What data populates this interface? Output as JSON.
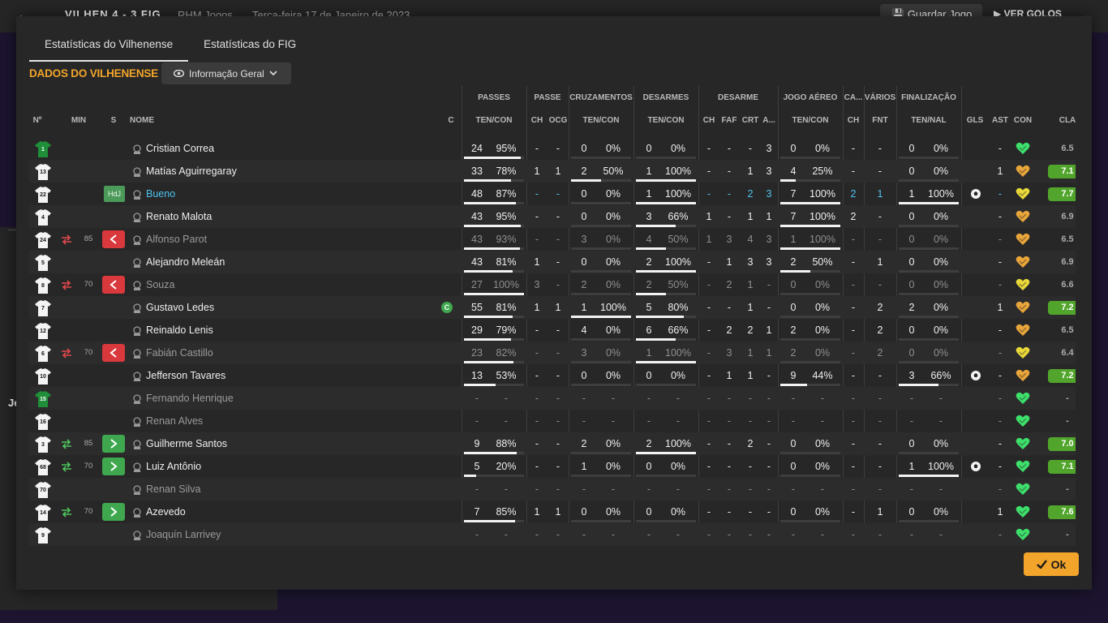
{
  "background": {
    "back_icon": "arrow-left-icon",
    "score": "VILHEN 4 - 3 FIG",
    "team": "RHM Jogos",
    "date": "Terça-feira 17 de Janeiro de 2023",
    "save_label": "Guardar Jogo",
    "goals_label": "VER GOLOS",
    "side_text": "Je"
  },
  "tabs": [
    {
      "label": "Estatísticas do Vilhenense",
      "active": true
    },
    {
      "label": "Estatísticas do FIG",
      "active": false
    }
  ],
  "section_title": "DADOS DO VILHENENSE",
  "dropdown": {
    "label": "Informação Geral",
    "icon": "eye-icon"
  },
  "columns": {
    "groups": {
      "passes": "PASSES",
      "passe": "PASSE",
      "cruzamentos": "CRUZAMENTOS",
      "desarmes": "DESARMES",
      "desarme": "DESARME",
      "jogo_aereo": "JOGO AÉREO",
      "ca": "CA...",
      "varios": "VÁRIOS",
      "finalizacao": "FINALIZAÇÃO"
    },
    "num": "Nº",
    "min": "MIN",
    "s": "S",
    "nome": "NOME",
    "c": "C",
    "pass_tc": "TEN/CON",
    "passe_ch": "CH",
    "passe_ocg": "OCG",
    "cruz_tc": "TEN/CON",
    "des_tc": "TEN/CON",
    "desarme_ch": "CH",
    "desarme_faf": "FAF",
    "desarme_crt": "CRT",
    "desarme_a": "A...",
    "aereo_tc": "TEN/CON",
    "ca_ch": "CH",
    "varios_fnt": "FNT",
    "fin_tn": "TEN/NAL",
    "gls": "GLS",
    "ast": "AST",
    "con": "CON",
    "cla": "CLA"
  },
  "players": [
    {
      "num": "1",
      "gk": true,
      "min": "",
      "sub": "",
      "name": "Cristian Correa",
      "style": "normal",
      "cap": false,
      "pass": [
        "24",
        "95%",
        0.95
      ],
      "passe_ch": "-",
      "passe_ocg": "-",
      "cruz": [
        "0",
        "0%",
        0
      ],
      "des": [
        "0",
        "0%",
        0
      ],
      "desarme": [
        "-",
        "-",
        "-",
        "3"
      ],
      "aereo": [
        "0",
        "0%",
        0
      ],
      "ca_ch": "-",
      "fnt": "-",
      "fin": [
        "0",
        "0%",
        0
      ],
      "gls": "",
      "ast": "-",
      "con": "green",
      "cla": "6.5",
      "cla_good": false
    },
    {
      "num": "13",
      "gk": false,
      "min": "",
      "sub": "",
      "name": "Matías Aguirregaray",
      "style": "normal",
      "cap": false,
      "pass": [
        "33",
        "78%",
        0.78
      ],
      "passe_ch": "1",
      "passe_ocg": "1",
      "cruz": [
        "2",
        "50%",
        0.5
      ],
      "des": [
        "1",
        "100%",
        1
      ],
      "desarme": [
        "-",
        "-",
        "1",
        "3"
      ],
      "aereo": [
        "4",
        "25%",
        0.25
      ],
      "ca_ch": "-",
      "fnt": "-",
      "fin": [
        "0",
        "0%",
        0
      ],
      "gls": "",
      "ast": "1",
      "con": "orange",
      "cla": "7.1",
      "cla_good": true
    },
    {
      "num": "22",
      "gk": false,
      "min": "",
      "sub": "HdJ",
      "name": "Bueno",
      "style": "blue",
      "cap": false,
      "pass": [
        "48",
        "87%",
        0.87
      ],
      "passe_ch": "-",
      "passe_ocg": "-",
      "cruz": [
        "0",
        "0%",
        0
      ],
      "des": [
        "1",
        "100%",
        1
      ],
      "desarme": [
        "-",
        "-",
        "2",
        "3"
      ],
      "aereo": [
        "7",
        "100%",
        1
      ],
      "ca_ch": "2",
      "fnt": "1",
      "fin": [
        "1",
        "100%",
        1
      ],
      "gls": "ball",
      "ast": "-",
      "con": "yellow",
      "cla": "7.7",
      "cla_good": true
    },
    {
      "num": "4",
      "gk": false,
      "min": "",
      "sub": "",
      "name": "Renato Malota",
      "style": "normal",
      "cap": false,
      "pass": [
        "43",
        "95%",
        0.95
      ],
      "passe_ch": "-",
      "passe_ocg": "-",
      "cruz": [
        "0",
        "0%",
        0
      ],
      "des": [
        "3",
        "66%",
        0.66
      ],
      "desarme": [
        "1",
        "-",
        "1",
        "1"
      ],
      "aereo": [
        "7",
        "100%",
        1
      ],
      "ca_ch": "2",
      "fnt": "-",
      "fin": [
        "0",
        "0%",
        0
      ],
      "gls": "",
      "ast": "-",
      "con": "orange",
      "cla": "6.9",
      "cla_good": false
    },
    {
      "num": "24",
      "gk": false,
      "min": "85",
      "sub": "out",
      "name": "Alfonso Parot",
      "style": "dim",
      "cap": false,
      "pass": [
        "43",
        "93%",
        0.93
      ],
      "passe_ch": "-",
      "passe_ocg": "-",
      "cruz": [
        "3",
        "0%",
        0
      ],
      "des": [
        "4",
        "50%",
        0.5
      ],
      "desarme": [
        "1",
        "3",
        "4",
        "3"
      ],
      "aereo": [
        "1",
        "100%",
        1
      ],
      "ca_ch": "-",
      "fnt": "-",
      "fin": [
        "0",
        "0%",
        0
      ],
      "gls": "",
      "ast": "-",
      "con": "orange",
      "cla": "6.5",
      "cla_good": false
    },
    {
      "num": "5",
      "gk": false,
      "min": "",
      "sub": "",
      "name": "Alejandro Meleán",
      "style": "normal",
      "cap": false,
      "pass": [
        "43",
        "81%",
        0.81
      ],
      "passe_ch": "1",
      "passe_ocg": "-",
      "cruz": [
        "0",
        "0%",
        0
      ],
      "des": [
        "2",
        "100%",
        1
      ],
      "desarme": [
        "-",
        "1",
        "3",
        "3"
      ],
      "aereo": [
        "2",
        "50%",
        0.5
      ],
      "ca_ch": "-",
      "fnt": "1",
      "fin": [
        "0",
        "0%",
        0
      ],
      "gls": "",
      "ast": "-",
      "con": "orange",
      "cla": "6.9",
      "cla_good": false
    },
    {
      "num": "8",
      "gk": false,
      "min": "70",
      "sub": "out",
      "name": "Souza",
      "style": "dim",
      "cap": false,
      "pass": [
        "27",
        "100%",
        1
      ],
      "passe_ch": "3",
      "passe_ocg": "-",
      "cruz": [
        "2",
        "0%",
        0
      ],
      "des": [
        "2",
        "50%",
        0.5
      ],
      "desarme": [
        "-",
        "2",
        "1",
        "-"
      ],
      "aereo": [
        "0",
        "0%",
        0
      ],
      "ca_ch": "-",
      "fnt": "-",
      "fin": [
        "0",
        "0%",
        0
      ],
      "gls": "",
      "ast": "-",
      "con": "yellow",
      "cla": "6.6",
      "cla_good": false
    },
    {
      "num": "7",
      "gk": false,
      "min": "",
      "sub": "",
      "name": "Gustavo Ledes",
      "style": "normal",
      "cap": true,
      "pass": [
        "55",
        "81%",
        0.81
      ],
      "passe_ch": "1",
      "passe_ocg": "1",
      "cruz": [
        "1",
        "100%",
        1
      ],
      "des": [
        "5",
        "80%",
        0.8
      ],
      "desarme": [
        "-",
        "-",
        "1",
        "-"
      ],
      "aereo": [
        "0",
        "0%",
        0
      ],
      "ca_ch": "-",
      "fnt": "2",
      "fin": [
        "2",
        "0%",
        0
      ],
      "gls": "",
      "ast": "1",
      "con": "orange",
      "cla": "7.2",
      "cla_good": true
    },
    {
      "num": "12",
      "gk": false,
      "min": "",
      "sub": "",
      "name": "Reinaldo Lenis",
      "style": "normal",
      "cap": false,
      "pass": [
        "29",
        "79%",
        0.79
      ],
      "passe_ch": "-",
      "passe_ocg": "-",
      "cruz": [
        "4",
        "0%",
        0
      ],
      "des": [
        "6",
        "66%",
        0.66
      ],
      "desarme": [
        "-",
        "2",
        "2",
        "1"
      ],
      "aereo": [
        "2",
        "0%",
        0
      ],
      "ca_ch": "-",
      "fnt": "2",
      "fin": [
        "0",
        "0%",
        0
      ],
      "gls": "",
      "ast": "-",
      "con": "orange",
      "cla": "6.5",
      "cla_good": false
    },
    {
      "num": "6",
      "gk": false,
      "min": "70",
      "sub": "out",
      "name": "Fabián Castillo",
      "style": "dim",
      "cap": false,
      "pass": [
        "23",
        "82%",
        0.82
      ],
      "passe_ch": "-",
      "passe_ocg": "-",
      "cruz": [
        "3",
        "0%",
        0
      ],
      "des": [
        "1",
        "100%",
        1
      ],
      "desarme": [
        "-",
        "3",
        "1",
        "1"
      ],
      "aereo": [
        "2",
        "0%",
        0
      ],
      "ca_ch": "-",
      "fnt": "2",
      "fin": [
        "0",
        "0%",
        0
      ],
      "gls": "",
      "ast": "-",
      "con": "yellow",
      "cla": "6.4",
      "cla_good": false
    },
    {
      "num": "10",
      "gk": false,
      "min": "",
      "sub": "",
      "name": "Jefferson Tavares",
      "style": "normal",
      "cap": false,
      "pass": [
        "13",
        "53%",
        0.53
      ],
      "passe_ch": "-",
      "passe_ocg": "-",
      "cruz": [
        "0",
        "0%",
        0
      ],
      "des": [
        "0",
        "0%",
        0
      ],
      "desarme": [
        "-",
        "1",
        "1",
        "-"
      ],
      "aereo": [
        "9",
        "44%",
        0.44
      ],
      "ca_ch": "-",
      "fnt": "-",
      "fin": [
        "3",
        "66%",
        0.66
      ],
      "gls": "ball",
      "ast": "-",
      "con": "orange",
      "cla": "7.2",
      "cla_good": true
    },
    {
      "num": "15",
      "gk": true,
      "min": "",
      "sub": "",
      "name": "Fernando Henrique",
      "style": "dim",
      "cap": false,
      "pass": [
        "-",
        "-",
        null
      ],
      "passe_ch": "-",
      "passe_ocg": "-",
      "cruz": [
        "-",
        "-",
        null
      ],
      "des": [
        "-",
        "-",
        null
      ],
      "desarme": [
        "-",
        "-",
        "-",
        "-"
      ],
      "aereo": [
        "-",
        "-",
        null
      ],
      "ca_ch": "-",
      "fnt": "-",
      "fin": [
        "-",
        "-",
        null
      ],
      "gls": "",
      "ast": "-",
      "con": "green",
      "cla": "-",
      "cla_good": false
    },
    {
      "num": "16",
      "gk": false,
      "min": "",
      "sub": "",
      "name": "Renan Alves",
      "style": "dim",
      "cap": false,
      "pass": [
        "-",
        "-",
        null
      ],
      "passe_ch": "-",
      "passe_ocg": "-",
      "cruz": [
        "-",
        "-",
        null
      ],
      "des": [
        "-",
        "-",
        null
      ],
      "desarme": [
        "-",
        "-",
        "-",
        "-"
      ],
      "aereo": [
        "-",
        "-",
        null
      ],
      "ca_ch": "-",
      "fnt": "-",
      "fin": [
        "-",
        "-",
        null
      ],
      "gls": "",
      "ast": "-",
      "con": "green",
      "cla": "-",
      "cla_good": false
    },
    {
      "num": "3",
      "gk": false,
      "min": "85",
      "sub": "in",
      "name": "Guilherme Santos",
      "style": "normal",
      "cap": false,
      "pass": [
        "9",
        "88%",
        0.88
      ],
      "passe_ch": "-",
      "passe_ocg": "-",
      "cruz": [
        "2",
        "0%",
        0
      ],
      "des": [
        "2",
        "100%",
        1
      ],
      "desarme": [
        "-",
        "-",
        "2",
        "-"
      ],
      "aereo": [
        "0",
        "0%",
        0
      ],
      "ca_ch": "-",
      "fnt": "-",
      "fin": [
        "0",
        "0%",
        0
      ],
      "gls": "",
      "ast": "-",
      "con": "green",
      "cla": "7.0",
      "cla_good": true
    },
    {
      "num": "68",
      "gk": false,
      "min": "70",
      "sub": "in",
      "name": "Luiz Antônio",
      "style": "normal",
      "cap": false,
      "pass": [
        "5",
        "20%",
        0.2
      ],
      "passe_ch": "-",
      "passe_ocg": "-",
      "cruz": [
        "1",
        "0%",
        0
      ],
      "des": [
        "0",
        "0%",
        0
      ],
      "desarme": [
        "-",
        "-",
        "-",
        "-"
      ],
      "aereo": [
        "0",
        "0%",
        0
      ],
      "ca_ch": "-",
      "fnt": "-",
      "fin": [
        "1",
        "100%",
        1
      ],
      "gls": "ball",
      "ast": "-",
      "con": "green",
      "cla": "7.1",
      "cla_good": true
    },
    {
      "num": "70",
      "gk": false,
      "min": "",
      "sub": "",
      "name": "Renan Silva",
      "style": "dim",
      "cap": false,
      "pass": [
        "-",
        "-",
        null
      ],
      "passe_ch": "-",
      "passe_ocg": "-",
      "cruz": [
        "-",
        "-",
        null
      ],
      "des": [
        "-",
        "-",
        null
      ],
      "desarme": [
        "-",
        "-",
        "-",
        "-"
      ],
      "aereo": [
        "-",
        "-",
        null
      ],
      "ca_ch": "-",
      "fnt": "-",
      "fin": [
        "-",
        "-",
        null
      ],
      "gls": "",
      "ast": "-",
      "con": "green",
      "cla": "-",
      "cla_good": false
    },
    {
      "num": "14",
      "gk": false,
      "min": "70",
      "sub": "in",
      "name": "Azevedo",
      "style": "normal",
      "cap": false,
      "pass": [
        "7",
        "85%",
        0.85
      ],
      "passe_ch": "1",
      "passe_ocg": "1",
      "cruz": [
        "0",
        "0%",
        0
      ],
      "des": [
        "0",
        "0%",
        0
      ],
      "desarme": [
        "-",
        "-",
        "-",
        "-"
      ],
      "aereo": [
        "0",
        "0%",
        0
      ],
      "ca_ch": "-",
      "fnt": "1",
      "fin": [
        "0",
        "0%",
        0
      ],
      "gls": "",
      "ast": "1",
      "con": "green",
      "cla": "7.6",
      "cla_good": true
    },
    {
      "num": "9",
      "gk": false,
      "min": "",
      "sub": "",
      "name": "Joaquín Larrivey",
      "style": "dim",
      "cap": false,
      "pass": [
        "-",
        "-",
        null
      ],
      "passe_ch": "-",
      "passe_ocg": "-",
      "cruz": [
        "-",
        "-",
        null
      ],
      "des": [
        "-",
        "-",
        null
      ],
      "desarme": [
        "-",
        "-",
        "-",
        "-"
      ],
      "aereo": [
        "-",
        "-",
        null
      ],
      "ca_ch": "-",
      "fnt": "-",
      "fin": [
        "-",
        "-",
        null
      ],
      "gls": "",
      "ast": "-",
      "con": "green",
      "cla": "-",
      "cla_good": false
    }
  ],
  "colors": {
    "accent": "#f2a52a",
    "rating_good": "#52a52c",
    "sub_out": "#d9383c",
    "sub_in": "#3fa84e",
    "con_green": "#3de06b",
    "con_yellow": "#e8d83a",
    "con_orange": "#e8a53a",
    "name_blue": "#4ec3f0"
  },
  "ok_button": {
    "label": "Ok",
    "icon": "check-icon"
  }
}
